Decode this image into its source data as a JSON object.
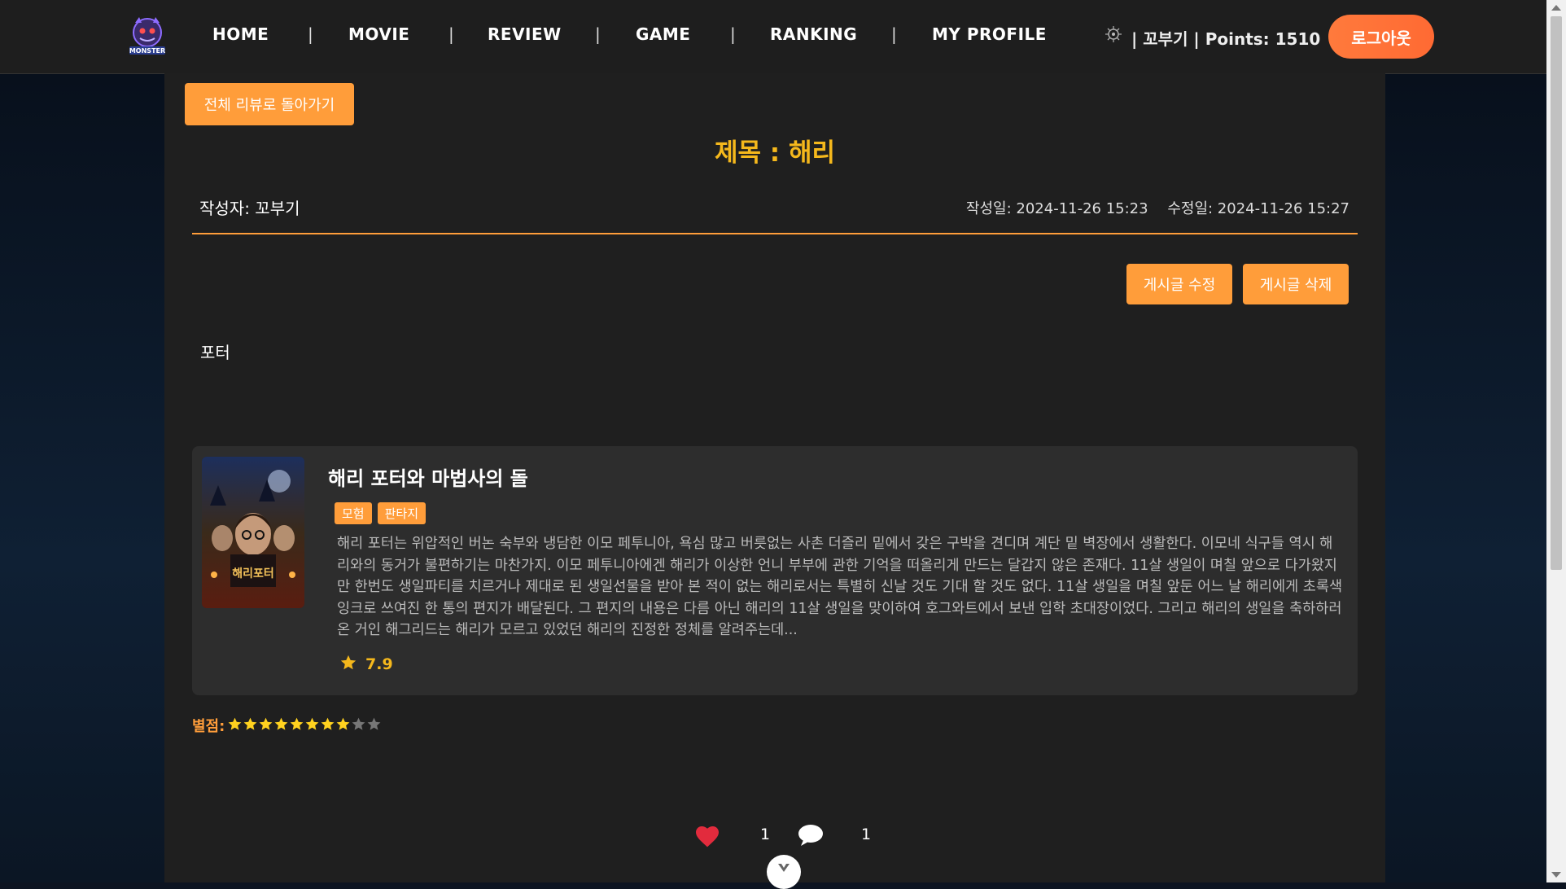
{
  "nav": {
    "items": [
      "HOME",
      "MOVIE",
      "REVIEW",
      "GAME",
      "RANKING",
      "MY PROFILE"
    ],
    "separator": "|",
    "logo_text": "MONSTER",
    "user_text": "| 꼬부기 | Points: 1510",
    "logout_label": "로그아웃"
  },
  "review": {
    "back_label": "전체 리뷰로 돌아가기",
    "title": "제목 : 해리",
    "author": "작성자: 꼬부기",
    "created": "작성일: 2024-11-26 15:23",
    "modified": "수정일: 2024-11-26 15:27",
    "edit_label": "게시글 수정",
    "delete_label": "게시글 삭제",
    "body": "포터",
    "stars_label": "별점:",
    "star_rating": 8,
    "star_max": 10,
    "likes": "1",
    "comments": "1"
  },
  "movie": {
    "title": "해리 포터와 마법사의 돌",
    "genres": [
      "모험",
      "판타지"
    ],
    "synopsis": "해리 포터는 위압적인 버논 숙부와 냉담한 이모 페투니아, 욕심 많고 버릇없는 사촌 더즐리 밑에서 갖은 구박을 견디며 계단 밑 벽장에서 생활한다. 이모네 식구들 역시 해리와의 동거가 불편하기는 마찬가지. 이모 페투니아에겐 해리가 이상한 언니 부부에 관한 기억을 떠올리게 만드는 달갑지 않은 존재다. 11살 생일이 며칠 앞으로 다가왔지만 한번도 생일파티를 치르거나 제대로 된 생일선물을 받아 본 적이 없는 해리로서는 특별히 신날 것도 기대 할 것도 없다. 11살 생일을 며칠 앞둔 어느 날 해리에게 초록색 잉크로 쓰여진 한 통의 편지가 배달된다. 그 편지의 내용은 다름 아닌 해리의 11살 생일을 맞이하여 호그와트에서 보낸 입학 초대장이었다. 그리고 해리의 생일을 축하하러 온 거인 해그리드는 해리가 모르고 있었던 해리의 진정한 정체를 알려주는데...",
    "rating": "7.9",
    "poster_text": "해리포터"
  },
  "colors": {
    "accent": "#ff9d3a",
    "title": "#f5b81c",
    "panel": "#1f1f1f",
    "card": "#2d2d2d"
  },
  "icons": [
    "monster-logo-icon",
    "user-badge-icon",
    "star-icon",
    "heart-icon",
    "comment-icon",
    "chevron-down-icon"
  ]
}
